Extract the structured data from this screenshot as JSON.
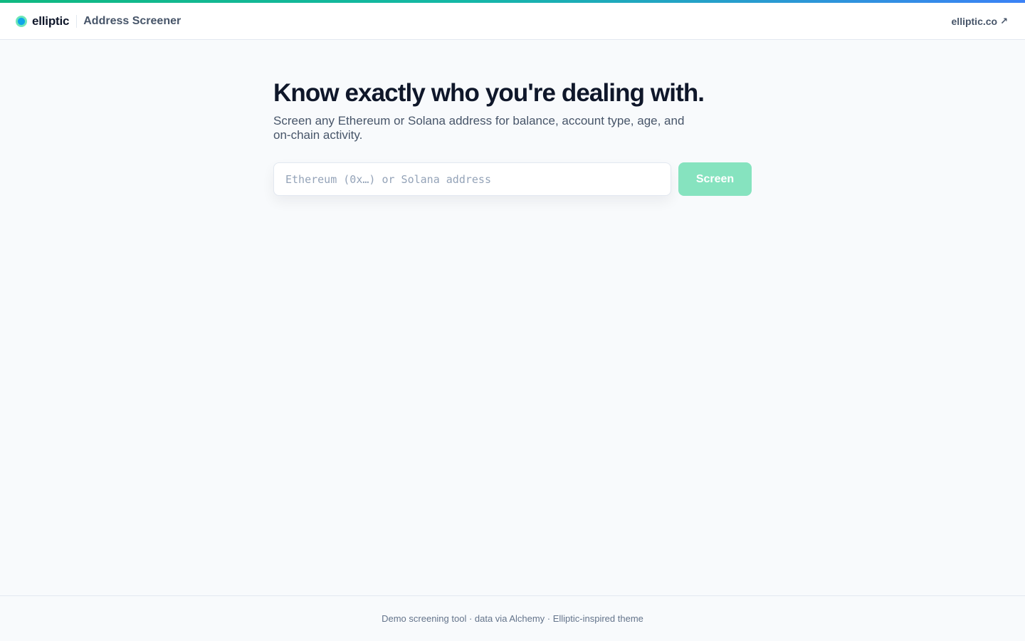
{
  "header": {
    "brand_name": "elliptic",
    "app_title": "Address Screener",
    "external_link_label": "elliptic.co",
    "external_link_icon": "↗"
  },
  "hero": {
    "title": "Know exactly who you're dealing with.",
    "subtitle": "Screen any Ethereum or Solana address for balance, account type, age, and on-chain activity."
  },
  "search": {
    "value": "",
    "placeholder": "Ethereum (0x…) or Solana address",
    "button_label": "Screen"
  },
  "footer": {
    "text": "Demo screening tool · data via Alchemy · Elliptic-inspired theme"
  },
  "colors": {
    "accent": "#10b981",
    "button_disabled": "#86e3bf",
    "page_bg": "#f8fafc"
  }
}
